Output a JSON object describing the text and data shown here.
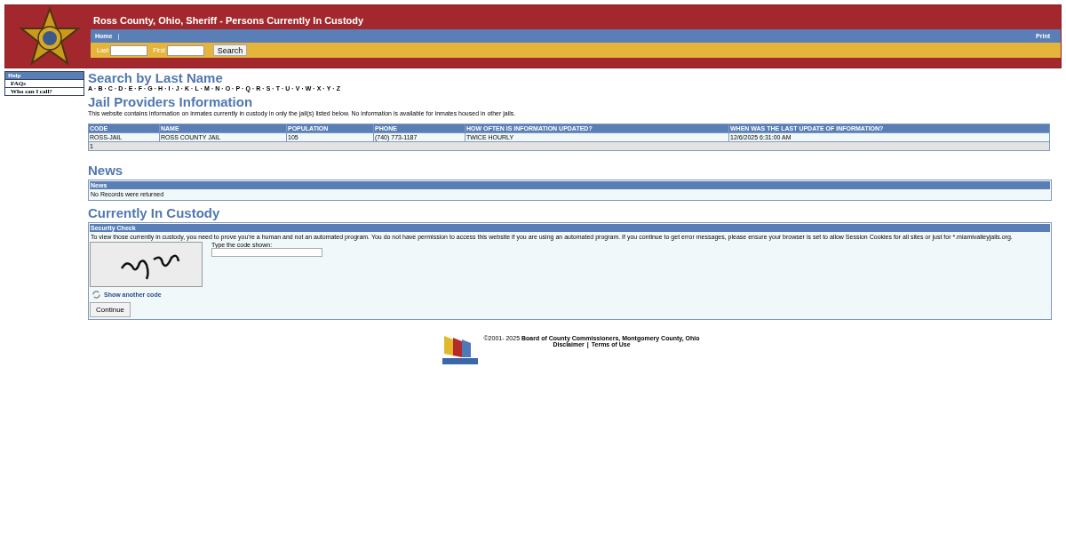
{
  "header": {
    "title": "Ross County, Ohio, Sheriff - Persons Currently In Custody",
    "nav": [
      {
        "label": "Home"
      }
    ],
    "nav_separator": "|",
    "print": "Print",
    "search": {
      "last_label": "Last",
      "first_label": "First",
      "button": "Search"
    }
  },
  "sidebar": {
    "heading": "Help",
    "items": [
      "FAQs",
      "Who can I call?"
    ]
  },
  "search_by_last_name": {
    "heading": "Search by Last Name",
    "letters": [
      "A",
      "B",
      "C",
      "D",
      "E",
      "F",
      "G",
      "H",
      "I",
      "J",
      "K",
      "L",
      "M",
      "N",
      "O",
      "P",
      "Q",
      "R",
      "S",
      "T",
      "U",
      "V",
      "W",
      "X",
      "Y",
      "Z"
    ],
    "separator": "·"
  },
  "jail_providers": {
    "heading": "Jail Providers Information",
    "description": "This website contains information on inmates currently in custody in only the jail(s) listed below. No information is available for inmates housed in other jails.",
    "columns": [
      "CODE",
      "NAME",
      "POPULATION",
      "PHONE",
      "HOW OFTEN IS INFORMATION UPDATED?",
      "WHEN WAS THE LAST UPDATE OF INFORMATION?"
    ],
    "rows": [
      [
        "ROSS-JAIL",
        "ROSS COUNTY JAIL",
        "105",
        "(740) 773-1187",
        "TWICE HOURLY",
        "12/6/2025 6:31:00 AM"
      ]
    ],
    "pager": "1"
  },
  "news": {
    "heading": "News",
    "panel_title": "News",
    "message": "No Records were returned"
  },
  "custody": {
    "heading": "Currently In Custody",
    "panel_title": "Security Check",
    "message": "To view those currently in custody, you need to prove you're a human and not an automated program. You do not have permission to access this website if you are using an automated program. If you continue to get error messages, please ensure your browser is set to allow Session Cookies for all sites or just for *.miamivalleyjails.org.",
    "code_label": "Type the code shown:",
    "refresh_link": "Show another code",
    "button": "Continue"
  },
  "footer": {
    "copyright": "©2001- 2025 **Board of County Commissioners, Montgomery County, Ohio**",
    "links": [
      "Disclaimer",
      "Terms of Use"
    ],
    "separator": "|"
  }
}
